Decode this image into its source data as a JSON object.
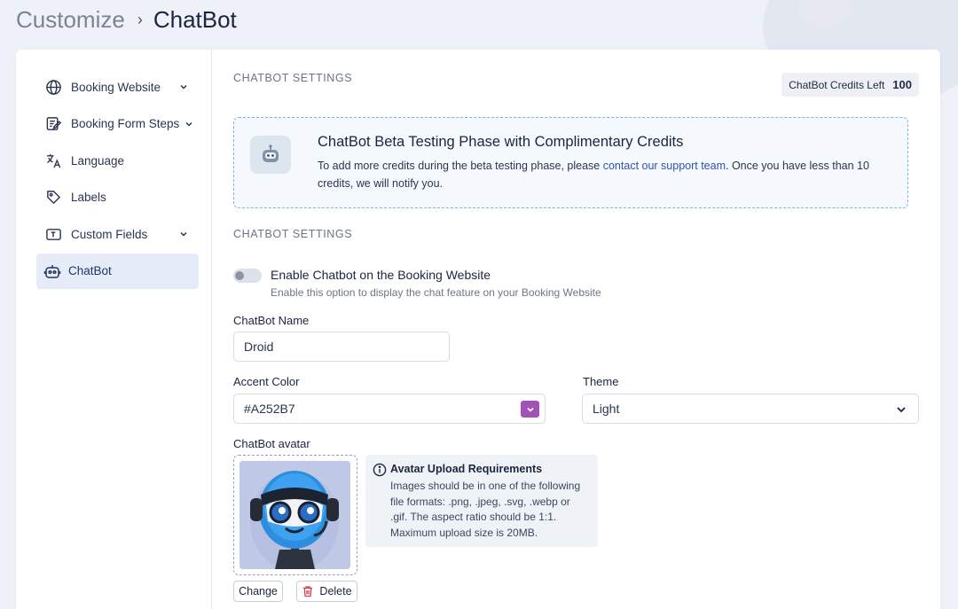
{
  "breadcrumb": {
    "parent": "Customize",
    "separator": "›",
    "current": "ChatBot"
  },
  "sidebar": {
    "items": [
      {
        "label": "Booking Website",
        "icon": "globe-icon",
        "has_chevron": true
      },
      {
        "label": "Booking Form Steps",
        "icon": "form-edit-icon",
        "has_chevron": true
      },
      {
        "label": "Language",
        "icon": "translate-icon",
        "has_chevron": false
      },
      {
        "label": "Labels",
        "icon": "tag-icon",
        "has_chevron": false
      },
      {
        "label": "Custom Fields",
        "icon": "text-field-icon",
        "has_chevron": true
      },
      {
        "label": "ChatBot",
        "icon": "robot-icon",
        "has_chevron": false,
        "active": true
      }
    ]
  },
  "main": {
    "section_title_1": "CHATBOT SETTINGS",
    "credits": {
      "label": "ChatBot Credits Left",
      "value": "100"
    },
    "beta": {
      "title": "ChatBot Beta Testing Phase with Complimentary Credits",
      "text_before": "To add more credits during the beta testing phase, please ",
      "link": "contact our support team",
      "text_after": ". Once you have less than 10 credits, we will notify you."
    },
    "section_title_2": "CHATBOT SETTINGS",
    "enable": {
      "label": "Enable Chatbot on the Booking Website",
      "help": "Enable this option to display the chat feature on your Booking Website",
      "enabled": false
    },
    "name_field": {
      "label": "ChatBot Name",
      "value": "Droid"
    },
    "accent_field": {
      "label": "Accent Color",
      "value": "#A252B7",
      "swatch_color": "#a252b7"
    },
    "theme_field": {
      "label": "Theme",
      "value": "Light"
    },
    "avatar": {
      "label": "ChatBot avatar",
      "req_title": "Avatar Upload Requirements",
      "req_text": "Images should be in one of the following file formats: .png, .jpeg, .svg, .webp or .gif. The aspect ratio should be 1:1. Maximum upload size is 20MB.",
      "change_label": "Change",
      "delete_label": "Delete"
    }
  },
  "colors": {
    "accent": "#a252b7",
    "link": "#2e56a6",
    "active_bg": "#e5ecf8",
    "delete_red": "#d83a4e"
  }
}
